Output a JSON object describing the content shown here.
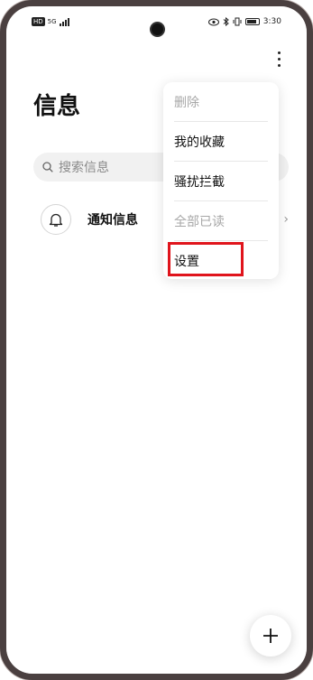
{
  "status_bar": {
    "network_badge": "HD",
    "signal_text": "5G",
    "time": "3:30"
  },
  "header": {
    "title": "信息",
    "more_icon": "more-vertical-icon"
  },
  "search": {
    "placeholder": "搜索信息",
    "icon": "search-icon"
  },
  "list": {
    "items": [
      {
        "label": "通知信息",
        "icon": "bell-icon"
      }
    ]
  },
  "menu": {
    "items": [
      {
        "label": "删除",
        "enabled": false
      },
      {
        "label": "我的收藏",
        "enabled": true
      },
      {
        "label": "骚扰拦截",
        "enabled": true
      },
      {
        "label": "全部已读",
        "enabled": false
      },
      {
        "label": "设置",
        "enabled": true,
        "highlighted": true
      }
    ]
  },
  "fab": {
    "icon": "plus-icon"
  },
  "colors": {
    "highlight_box": "#e0141c",
    "disabled_text": "#a7a7a7"
  }
}
